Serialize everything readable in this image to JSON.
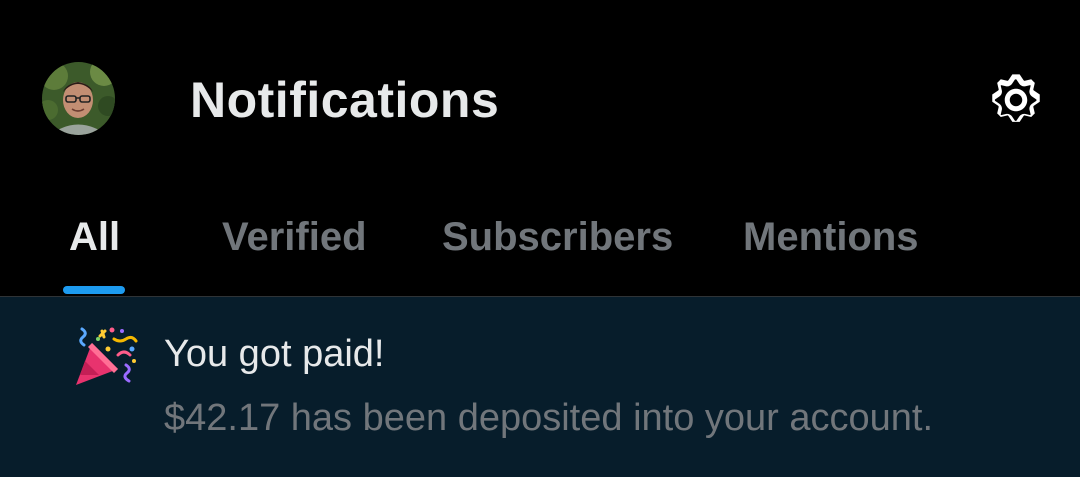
{
  "header": {
    "title": "Notifications",
    "avatar_icon": "user-avatar",
    "settings_icon": "gear-icon"
  },
  "tabs": [
    {
      "label": "All",
      "active": true
    },
    {
      "label": "Verified",
      "active": false
    },
    {
      "label": "Subscribers",
      "active": false
    },
    {
      "label": "Mentions",
      "active": false
    }
  ],
  "notification": {
    "icon": "party-popper-icon",
    "title": "You got paid!",
    "body": "$42.17 has been deposited into your account."
  },
  "colors": {
    "background": "#000000",
    "accent": "#1d9bf0",
    "primary_text": "#e7e9ea",
    "secondary_text": "#71767b",
    "notification_background": "#071d2b"
  }
}
